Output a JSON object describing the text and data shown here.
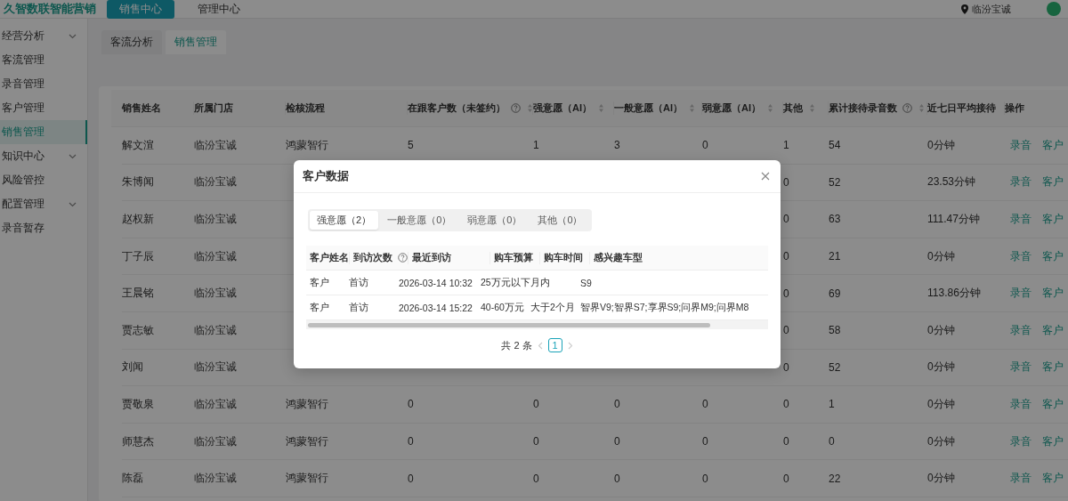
{
  "header": {
    "brand": "久智数联智能营销",
    "nav": [
      {
        "label": "销售中心",
        "selected": true
      },
      {
        "label": "管理中心",
        "selected": false
      }
    ],
    "location": "临汾宝诚"
  },
  "sidebar": {
    "items": [
      {
        "label": "经营分析",
        "expandable": true,
        "selected": false
      },
      {
        "label": "客流管理",
        "expandable": false,
        "selected": false
      },
      {
        "label": "录音管理",
        "expandable": false,
        "selected": false
      },
      {
        "label": "客户管理",
        "expandable": false,
        "selected": false
      },
      {
        "label": "销售管理",
        "expandable": false,
        "selected": true
      },
      {
        "label": "知识中心",
        "expandable": true,
        "selected": false
      },
      {
        "label": "风险管控",
        "expandable": false,
        "selected": false
      },
      {
        "label": "配置管理",
        "expandable": true,
        "selected": false
      },
      {
        "label": "录音暂存",
        "expandable": false,
        "selected": false
      }
    ]
  },
  "tabs": [
    {
      "label": "客流分析",
      "selected": false
    },
    {
      "label": "销售管理",
      "selected": true
    }
  ],
  "table": {
    "columns": [
      {
        "label": "销售姓名",
        "help": false,
        "sortable": false
      },
      {
        "label": "所属门店",
        "help": false,
        "sortable": false
      },
      {
        "label": "检核流程",
        "help": false,
        "sortable": false
      },
      {
        "label": "在跟客户数（未签约）",
        "help": true,
        "sortable": true
      },
      {
        "label": "强意愿（AI）",
        "help": false,
        "sortable": true
      },
      {
        "label": "一般意愿（AI）",
        "help": false,
        "sortable": true
      },
      {
        "label": "弱意愿（AI）",
        "help": false,
        "sortable": true
      },
      {
        "label": "其他",
        "help": false,
        "sortable": true
      },
      {
        "label": "累计接待录音数",
        "help": true,
        "sortable": true
      },
      {
        "label": "近七日平均接待",
        "help": false,
        "sortable": false
      },
      {
        "label": "操作",
        "help": false,
        "sortable": false
      }
    ],
    "rows": [
      {
        "cells": [
          "解文渲",
          "临汾宝诚",
          "鸿蒙智行",
          "5",
          "1",
          "3",
          "0",
          "1",
          "54",
          "0分钟"
        ],
        "actions": [
          "录音",
          "客户"
        ]
      },
      {
        "cells": [
          "朱博闻",
          "临汾宝诚",
          null,
          null,
          null,
          null,
          null,
          "0",
          "52",
          "23.53分钟"
        ],
        "actions": [
          "录音",
          "客户"
        ]
      },
      {
        "cells": [
          "赵权新",
          "临汾宝诚",
          null,
          null,
          null,
          null,
          null,
          "0",
          "63",
          "111.47分钟"
        ],
        "actions": [
          "录音",
          "客户"
        ]
      },
      {
        "cells": [
          "丁子辰",
          "临汾宝诚",
          null,
          null,
          null,
          null,
          null,
          "0",
          "21",
          "0分钟"
        ],
        "actions": [
          "录音",
          "客户"
        ]
      },
      {
        "cells": [
          "王晨铭",
          "临汾宝诚",
          null,
          null,
          null,
          null,
          null,
          "0",
          "69",
          "113.86分钟"
        ],
        "actions": [
          "录音",
          "客户"
        ]
      },
      {
        "cells": [
          "贾志敏",
          "临汾宝诚",
          null,
          null,
          null,
          null,
          null,
          "0",
          "58",
          "0分钟"
        ],
        "actions": [
          "录音",
          "客户"
        ]
      },
      {
        "cells": [
          "刘闻",
          "临汾宝诚",
          null,
          null,
          null,
          null,
          null,
          "0",
          "52",
          "0分钟"
        ],
        "actions": [
          "录音",
          "客户"
        ]
      },
      {
        "cells": [
          "贾敬泉",
          "临汾宝诚",
          "鸿蒙智行",
          "0",
          "0",
          "0",
          "0",
          "0",
          "1",
          "0分钟"
        ],
        "actions": [
          "录音",
          "客户"
        ]
      },
      {
        "cells": [
          "师慧杰",
          "临汾宝诚",
          "鸿蒙智行",
          "0",
          "0",
          "0",
          "0",
          "0",
          "0",
          "0分钟"
        ],
        "actions": [
          "录音",
          "客户"
        ]
      },
      {
        "cells": [
          "陈磊",
          "临汾宝诚",
          "鸿蒙智行",
          "0",
          "0",
          "0",
          "0",
          "0",
          "22",
          "0分钟"
        ],
        "actions": [
          "录音",
          "客户"
        ]
      }
    ]
  },
  "modal": {
    "title": "客户数据",
    "segments": [
      {
        "label": "强意愿（2）",
        "selected": true
      },
      {
        "label": "一般意愿（0）",
        "selected": false
      },
      {
        "label": "弱意愿（0）",
        "selected": false
      },
      {
        "label": "其他（0）",
        "selected": false
      }
    ],
    "columns": [
      {
        "label": "客户姓名",
        "help": false
      },
      {
        "label": "到访次数",
        "help": true
      },
      {
        "label": "最近到访",
        "help": false
      },
      {
        "label": "购车预算",
        "help": false
      },
      {
        "label": "购车时间",
        "help": false
      },
      {
        "label": "感兴趣车型",
        "help": false
      }
    ],
    "rows": [
      [
        "客户",
        "首访",
        "2026-03-14 10:32",
        "25万元以下",
        "月内",
        "S9"
      ],
      [
        "客户",
        "首访",
        "2026-03-14 15:22",
        "40-60万元",
        "大于2个月",
        "智界V9;智界S7;享界S9;问界M9;问界M8"
      ]
    ],
    "pagination": {
      "total": "共 2 条",
      "pages": [
        {
          "label": "1",
          "selected": true
        }
      ]
    }
  }
}
